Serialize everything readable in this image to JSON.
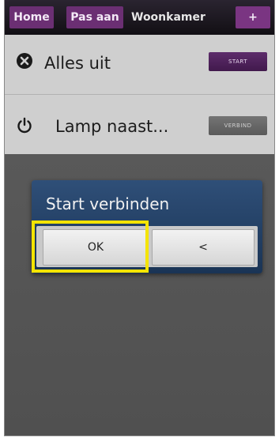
{
  "topbar": {
    "home_label": "Home",
    "pas_aan_label": "Pas aan",
    "room_title": "Woonkamer",
    "add_label": "+"
  },
  "list": {
    "items": [
      {
        "label": "Alles uit",
        "icon": "close-circle-icon",
        "button_label": "START"
      },
      {
        "label": "Lamp naast...",
        "icon": "power-icon",
        "button_label": "VERBIND"
      }
    ]
  },
  "dialog": {
    "title": "Start verbinden",
    "ok_label": "OK",
    "back_label": "<"
  },
  "colors": {
    "accent_purple": "#6b2f73",
    "dialog_blue": "#2f4f78",
    "highlight_yellow": "#f4e400"
  }
}
